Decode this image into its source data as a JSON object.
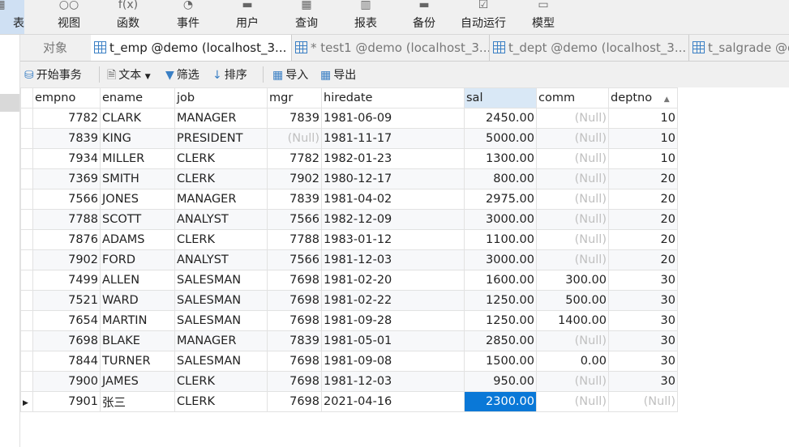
{
  "top_toolbar": [
    {
      "label": "表",
      "icon": "table-icon"
    },
    {
      "label": "视图",
      "icon": "view-icon"
    },
    {
      "label": "函数",
      "icon": "function-icon"
    },
    {
      "label": "事件",
      "icon": "event-icon"
    },
    {
      "label": "用户",
      "icon": "user-icon"
    },
    {
      "label": "查询",
      "icon": "query-icon"
    },
    {
      "label": "报表",
      "icon": "report-icon"
    },
    {
      "label": "备份",
      "icon": "backup-icon"
    },
    {
      "label": "自动运行",
      "icon": "autorun-icon"
    },
    {
      "label": "模型",
      "icon": "model-icon"
    }
  ],
  "tabs": [
    {
      "label": "对象"
    },
    {
      "label": "t_emp @demo (localhost_3..."
    },
    {
      "label": "* test1 @demo (localhost_3..."
    },
    {
      "label": "t_dept @demo (localhost_3..."
    },
    {
      "label": "t_salgrade @demo"
    }
  ],
  "toolbar": {
    "begin_tx": "开始事务",
    "text": "文本",
    "filter": "筛选",
    "sort": "排序",
    "import": "导入",
    "export": "导出"
  },
  "columns": [
    "empno",
    "ename",
    "job",
    "mgr",
    "hiredate",
    "sal",
    "comm",
    "deptno"
  ],
  "null_text": "(Null)",
  "rows": [
    [
      "7782",
      "CLARK",
      "MANAGER",
      "7839",
      "1981-06-09",
      "2450.00",
      null,
      "10"
    ],
    [
      "7839",
      "KING",
      "PRESIDENT",
      null,
      "1981-11-17",
      "5000.00",
      null,
      "10"
    ],
    [
      "7934",
      "MILLER",
      "CLERK",
      "7782",
      "1982-01-23",
      "1300.00",
      null,
      "10"
    ],
    [
      "7369",
      "SMITH",
      "CLERK",
      "7902",
      "1980-12-17",
      "800.00",
      null,
      "20"
    ],
    [
      "7566",
      "JONES",
      "MANAGER",
      "7839",
      "1981-04-02",
      "2975.00",
      null,
      "20"
    ],
    [
      "7788",
      "SCOTT",
      "ANALYST",
      "7566",
      "1982-12-09",
      "3000.00",
      null,
      "20"
    ],
    [
      "7876",
      "ADAMS",
      "CLERK",
      "7788",
      "1983-01-12",
      "1100.00",
      null,
      "20"
    ],
    [
      "7902",
      "FORD",
      "ANALYST",
      "7566",
      "1981-12-03",
      "3000.00",
      null,
      "20"
    ],
    [
      "7499",
      "ALLEN",
      "SALESMAN",
      "7698",
      "1981-02-20",
      "1600.00",
      "300.00",
      "30"
    ],
    [
      "7521",
      "WARD",
      "SALESMAN",
      "7698",
      "1981-02-22",
      "1250.00",
      "500.00",
      "30"
    ],
    [
      "7654",
      "MARTIN",
      "SALESMAN",
      "7698",
      "1981-09-28",
      "1250.00",
      "1400.00",
      "30"
    ],
    [
      "7698",
      "BLAKE",
      "MANAGER",
      "7839",
      "1981-05-01",
      "2850.00",
      null,
      "30"
    ],
    [
      "7844",
      "TURNER",
      "SALESMAN",
      "7698",
      "1981-09-08",
      "1500.00",
      "0.00",
      "30"
    ],
    [
      "7900",
      "JAMES",
      "CLERK",
      "7698",
      "1981-12-03",
      "950.00",
      null,
      "30"
    ],
    [
      "7901",
      "张三",
      "CLERK",
      "7698",
      "2021-04-16",
      "2300.00",
      null,
      null
    ]
  ]
}
